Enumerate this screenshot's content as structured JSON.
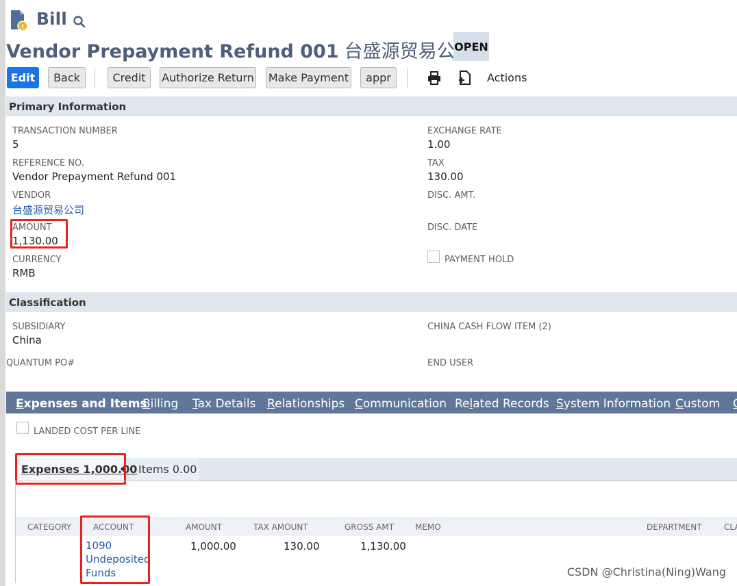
{
  "header": {
    "record_type": "Bill",
    "title": "Vendor Prepayment Refund 001",
    "title_vendor": "台盛源贸易公司",
    "status": "OPEN"
  },
  "toolbar": {
    "edit": "Edit",
    "back": "Back",
    "credit": "Credit",
    "authorize_return": "Authorize Return",
    "make_payment": "Make Payment",
    "appr": "appr",
    "actions": "Actions"
  },
  "primary": {
    "title": "Primary Information",
    "transaction_number": {
      "label": "TRANSACTION NUMBER",
      "value": "5"
    },
    "reference_no": {
      "label": "REFERENCE NO.",
      "value": "Vendor Prepayment Refund 001"
    },
    "vendor": {
      "label": "VENDOR",
      "value": "台盛源贸易公司"
    },
    "amount": {
      "label": "AMOUNT",
      "value": "1,130.00"
    },
    "currency": {
      "label": "CURRENCY",
      "value": "RMB"
    },
    "exchange_rate": {
      "label": "EXCHANGE RATE",
      "value": "1.00"
    },
    "tax": {
      "label": "TAX",
      "value": "130.00"
    },
    "disc_amt": {
      "label": "DISC. AMT."
    },
    "disc_date": {
      "label": "DISC. DATE"
    },
    "payment_hold": {
      "label": "PAYMENT HOLD"
    }
  },
  "classification": {
    "title": "Classification",
    "subsidiary": {
      "label": "SUBSIDIARY",
      "value": "China"
    },
    "quantum_po": {
      "label": "QUANTUM PO#"
    },
    "china_cash_flow": {
      "label": "CHINA CASH FLOW ITEM (2)"
    },
    "end_user": {
      "label": "END USER"
    }
  },
  "tabs": [
    {
      "first": "E",
      "rest": "xpenses and Items"
    },
    {
      "first": "B",
      "rest": "illing"
    },
    {
      "first": "T",
      "rest": "ax Details"
    },
    {
      "first": "R",
      "rest": "elationships"
    },
    {
      "first": "C",
      "rest": "ommunication"
    },
    {
      "first": "Re",
      "mid": "l",
      "rest": "ated Records"
    },
    {
      "first": "S",
      "rest": "ystem Information"
    },
    {
      "first": "C",
      "rest": "ustom"
    },
    {
      "first": "C",
      "rest": ""
    }
  ],
  "expenses": {
    "landed_cost_label": "LANDED COST PER LINE",
    "subtab_expenses": "Expenses 1,000.00",
    "subtab_dot": "•",
    "subtab_items": "Items 0.00",
    "columns": [
      "CATEGORY",
      "ACCOUNT",
      "AMOUNT",
      "TAX AMOUNT",
      "GROSS AMT",
      "MEMO",
      "DEPARTMENT",
      "CLA"
    ],
    "row": {
      "account_line1": "1090",
      "account_line2": "Undeposited",
      "account_line3": "Funds",
      "amount": "1,000.00",
      "tax_amount": "130.00",
      "gross_amt": "1,130.00"
    }
  },
  "watermark": "CSDN @Christina(Ning)Wang",
  "colors": {
    "accent_blue": "#1a73e8",
    "tab_bar": "#607799",
    "section_bar": "#e0e6ee",
    "highlight_red": "#e8231c"
  }
}
